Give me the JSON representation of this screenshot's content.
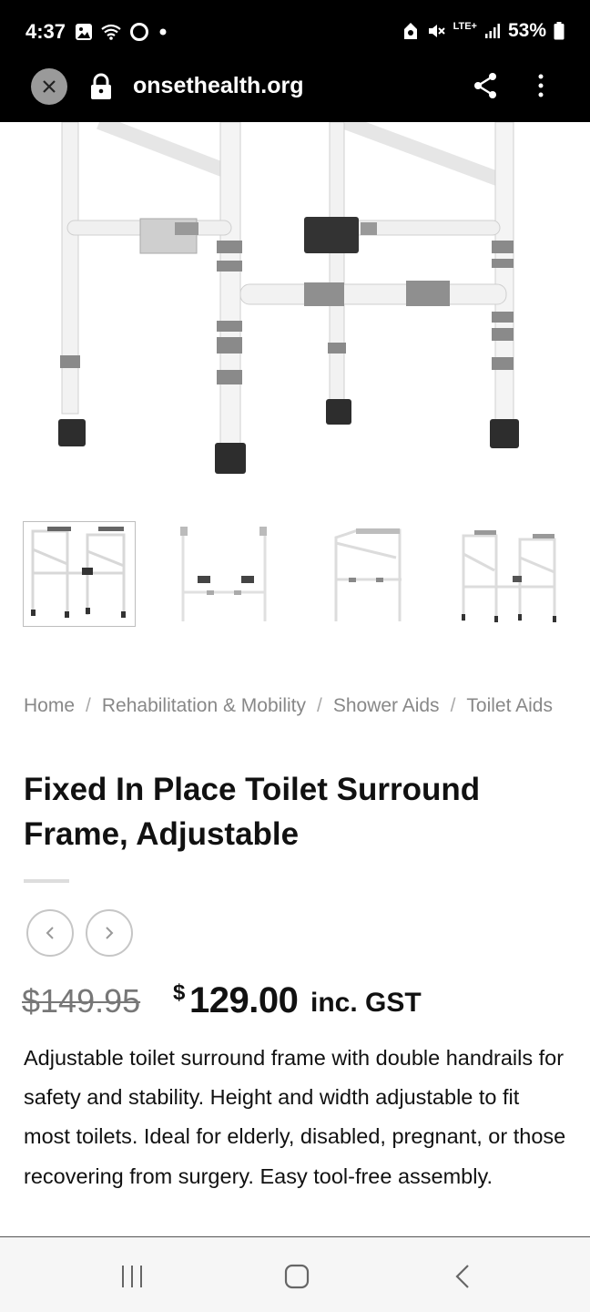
{
  "status_bar": {
    "time": "4:37",
    "network": "LTE+",
    "battery": "53%",
    "icons": [
      "image-icon",
      "wifi-icon",
      "ring-icon",
      "dot-icon",
      "alarm-icon",
      "mute-icon",
      "signal-icon",
      "battery-icon"
    ]
  },
  "browser": {
    "url": "onsethealth.org",
    "icons": [
      "close-icon",
      "lock-icon",
      "share-icon",
      "more-vert-icon"
    ]
  },
  "gallery": {
    "thumbnails": [
      "front-view",
      "side-view",
      "angle-view",
      "pair-view"
    ],
    "selected_index": 0
  },
  "breadcrumb": {
    "items": [
      "Home",
      "Rehabilitation & Mobility",
      "Shower Aids",
      "Toilet Aids"
    ]
  },
  "product": {
    "title_line1": "Fixed In Place Toilet Surround",
    "title_line2": "Frame, Adjustable",
    "old_price": "$149.95",
    "currency_symbol": "$",
    "price": "129.00",
    "price_suffix": "inc. GST",
    "description": "Adjustable toilet surround frame with double handrails for safety and stability. Height and width adjustable to fit most toilets. Ideal for elderly, disabled, pregnant, or those recovering from surgery. Easy tool-free assembly."
  },
  "product_nav": {
    "icons": [
      "chevron-left-icon",
      "chevron-right-icon"
    ]
  },
  "bottom_nav": {
    "icons": [
      "recents-icon",
      "home-icon",
      "back-icon"
    ]
  }
}
